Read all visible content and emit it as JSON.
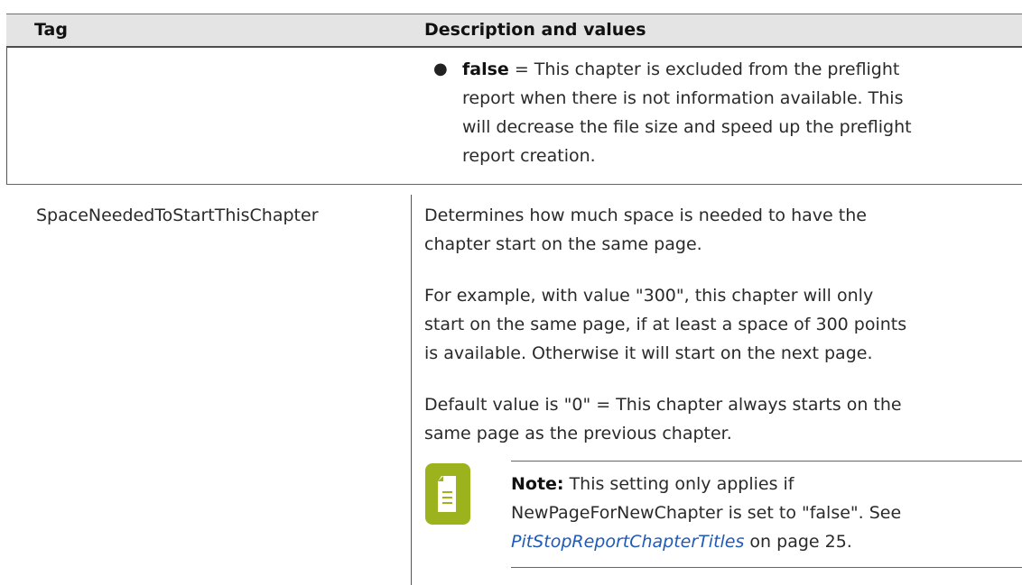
{
  "table": {
    "headers": {
      "tag": "Tag",
      "description": "Description and values"
    },
    "row1": {
      "tag": "",
      "bullet_value": "false",
      "bullet_lines": [
        " = This chapter is excluded from the preflight",
        "report when there is not information available. This",
        "will decrease the file size and speed up the preflight",
        "report creation."
      ]
    },
    "row2": {
      "tag": "SpaceNeededToStartThisChapter",
      "para1": [
        "Determines how much space is needed to have the",
        "chapter start on the same page."
      ],
      "para2": [
        "For example, with value \"300\", this chapter will only",
        "start on the same page, if at least a space of 300 points",
        "is available. Otherwise it will start on the next page."
      ],
      "para3": [
        "Default value is \"0\" = This chapter always starts on the",
        "same page as the previous chapter."
      ],
      "note": {
        "label": "Note:",
        "line1_rest": "  This setting only applies if",
        "line2": "NewPageForNewChapter is set to \"false\". See",
        "link_text": "PitStopReportChapterTitles",
        "link_suffix": " on page 25."
      }
    }
  },
  "colors": {
    "accent": "#9cb31e",
    "link": "#1f5ab8"
  },
  "icons": {
    "note": "note-document-icon"
  }
}
